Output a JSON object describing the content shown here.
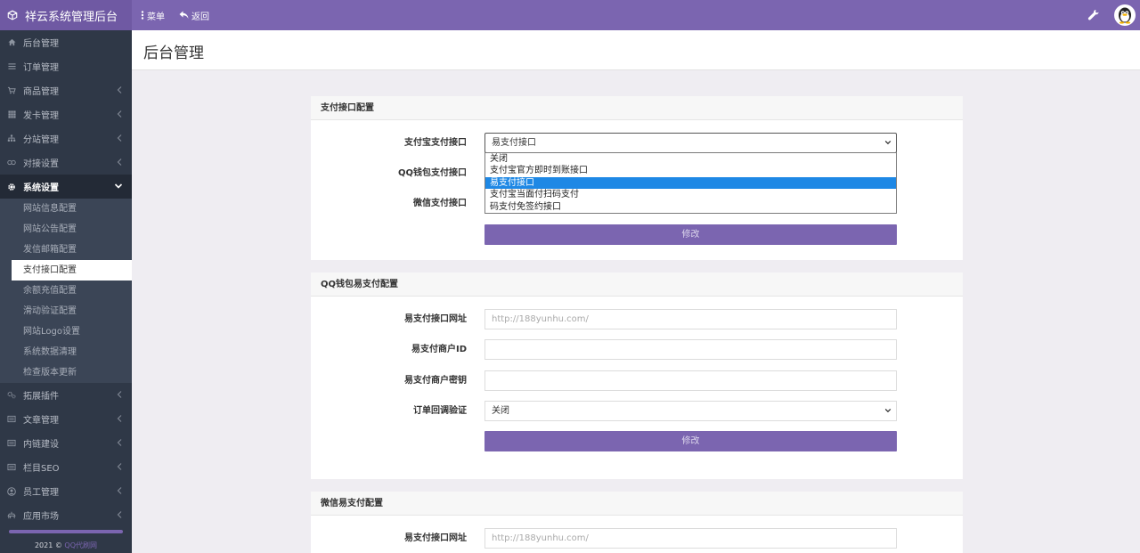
{
  "app": {
    "brand": "祥云系统管理后台"
  },
  "topbar": {
    "menu_label": "菜单",
    "back_label": "返回"
  },
  "sidebar": {
    "items": [
      {
        "label": "后台管理",
        "icon": "home-icon"
      },
      {
        "label": "订单管理",
        "icon": "list-icon"
      },
      {
        "label": "商品管理",
        "icon": "cart-icon"
      },
      {
        "label": "发卡管理",
        "icon": "grid-icon"
      },
      {
        "label": "分站管理",
        "icon": "sitemap-icon"
      },
      {
        "label": "对接设置",
        "icon": "link-icon"
      },
      {
        "label": "系统设置",
        "icon": "gear-icon"
      }
    ],
    "submenu": [
      "网站信息配置",
      "网站公告配置",
      "发信邮箱配置",
      "支付接口配置",
      "余额充值配置",
      "滑动验证配置",
      "网站Logo设置",
      "系统数据清理",
      "检查版本更新"
    ],
    "current_sub": "支付接口配置",
    "items_after": [
      {
        "label": "拓展插件",
        "icon": "gears-icon"
      },
      {
        "label": "文章管理",
        "icon": "article-icon"
      },
      {
        "label": "内链建设",
        "icon": "article-icon"
      },
      {
        "label": "栏目SEO",
        "icon": "article-icon"
      },
      {
        "label": "员工管理",
        "icon": "user-icon"
      },
      {
        "label": "应用市场",
        "icon": "store-icon"
      }
    ],
    "footer_prefix": "2021 © ",
    "footer_link": "QQ代刷网"
  },
  "page": {
    "title": "后台管理"
  },
  "panel1": {
    "title": "支付接口配置",
    "alipay_label": "支付宝支付接口",
    "alipay_value": "易支付接口",
    "qq_label": "QQ钱包支付接口",
    "wechat_label": "微信支付接口",
    "submit_label": "修改",
    "dropdown_options": [
      "关闭",
      "支付宝官方即时到账接口",
      "易支付接口",
      "支付宝当面付扫码支付",
      "码支付免签约接口"
    ],
    "dropdown_selected_index": 2
  },
  "panel2": {
    "title": "QQ钱包易支付配置",
    "url_label": "易支付接口网址",
    "url_placeholder": "http://188yunhu.com/",
    "merchant_id_label": "易支付商户ID",
    "merchant_key_label": "易支付商户密钥",
    "callback_label": "订单回调验证",
    "callback_value": "关闭",
    "submit_label": "修改"
  },
  "panel3": {
    "title": "微信易支付配置",
    "url_label": "易支付接口网址",
    "url_placeholder": "http://188yunhu.com/"
  },
  "colors": {
    "accent": "#7b65b0",
    "sidebar_bg": "#2f3847",
    "dropdown_highlight": "#1e88e5"
  }
}
